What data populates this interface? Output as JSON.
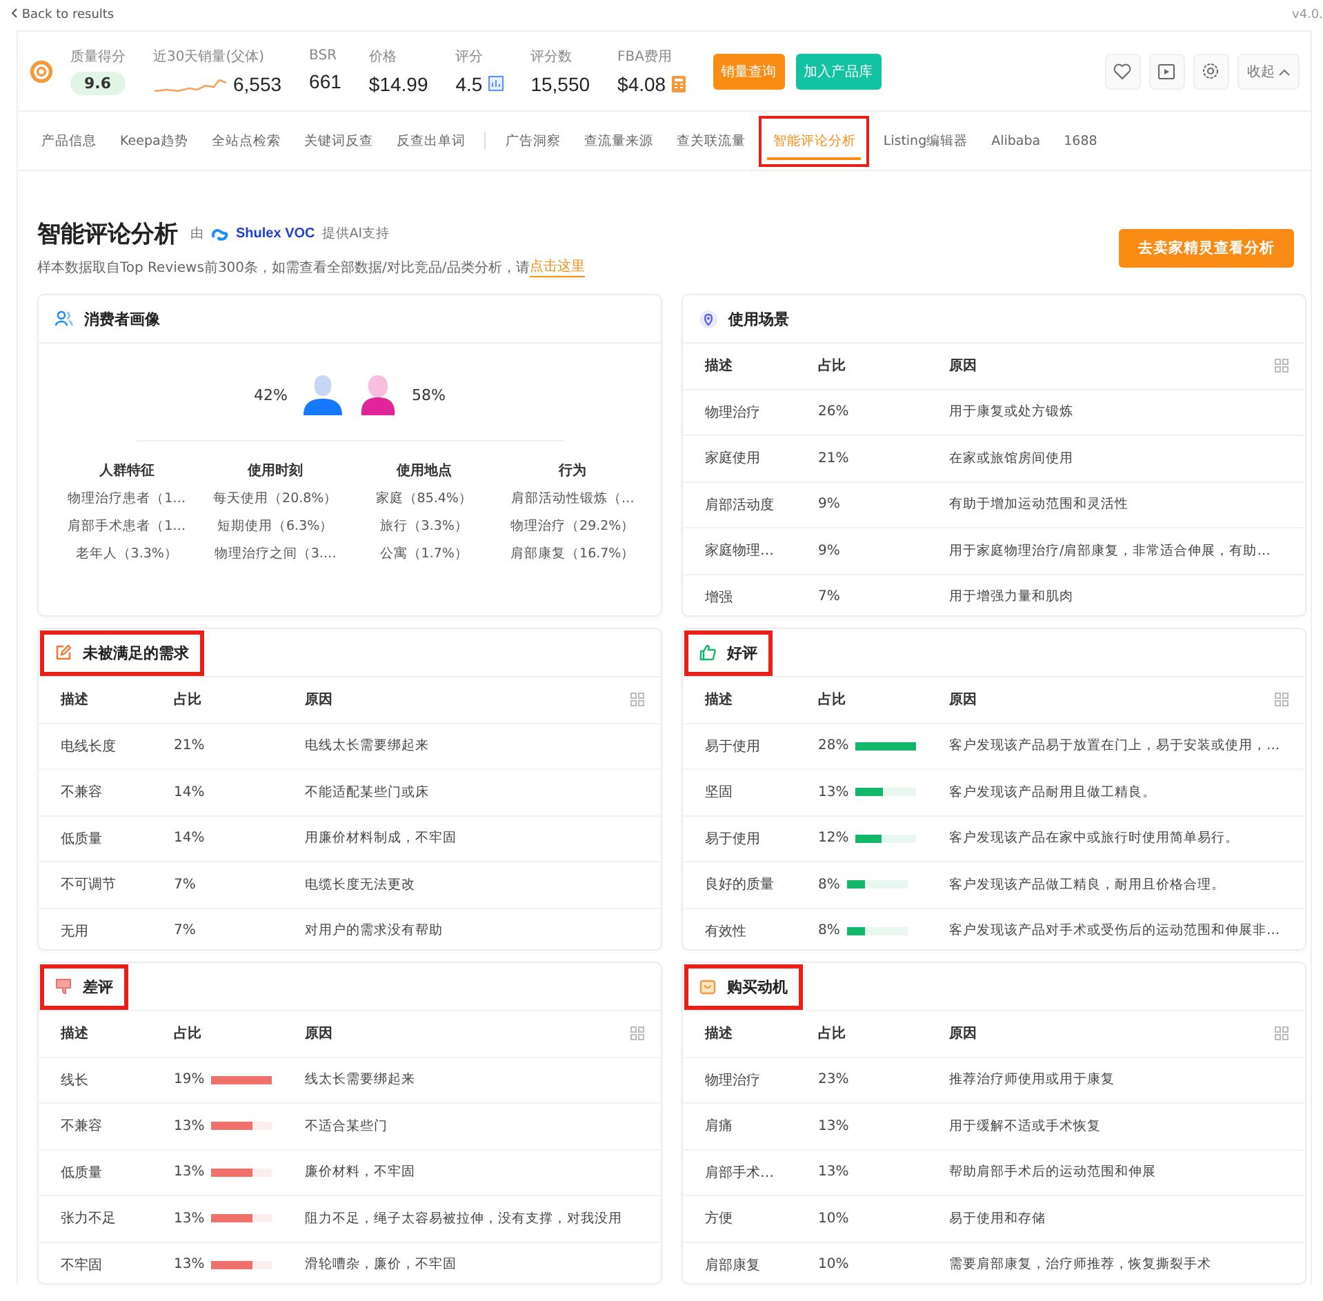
{
  "top_bar": {
    "back_link": "Back to results",
    "version": "v4.0."
  },
  "stats": [
    {
      "label": "质量得分",
      "value": "9.6",
      "kind": "badge"
    },
    {
      "label": "近30天销量(父体)",
      "value": "6,553",
      "kind": "sparkline"
    },
    {
      "label": "BSR",
      "value": "661",
      "kind": "plain"
    },
    {
      "label": "价格",
      "value": "$14.99",
      "kind": "plain"
    },
    {
      "label": "评分",
      "value": "4.5",
      "kind": "rating"
    },
    {
      "label": "评分数",
      "value": "15,550",
      "kind": "plain"
    },
    {
      "label": "FBA费用",
      "value": "$4.08",
      "kind": "calculator"
    }
  ],
  "action_buttons": [
    {
      "label": "销量查询",
      "color": "#fa8c16"
    },
    {
      "label": "加入产品库",
      "color": "#13c2a3"
    }
  ],
  "collapse_button": "收起",
  "tab_groups": [
    [
      {
        "label": "产品信息",
        "selected": false,
        "highlighted": false
      },
      {
        "label": "Keepa趋势",
        "selected": false,
        "highlighted": false
      },
      {
        "label": "全站点检索",
        "selected": false,
        "highlighted": false
      },
      {
        "label": "关键词反查",
        "selected": false,
        "highlighted": false
      },
      {
        "label": "反查出单词",
        "selected": false,
        "highlighted": false
      }
    ],
    [
      {
        "label": "广告洞察",
        "selected": false,
        "highlighted": false
      },
      {
        "label": "查流量来源",
        "selected": false,
        "highlighted": false
      },
      {
        "label": "查关联流量",
        "selected": false,
        "highlighted": false
      },
      {
        "label": "智能评论分析",
        "selected": true,
        "highlighted": true
      },
      {
        "label": "Listing编辑器",
        "selected": false,
        "highlighted": false
      },
      {
        "label": "Alibaba",
        "selected": false,
        "highlighted": false
      },
      {
        "label": "1688",
        "selected": false,
        "highlighted": false
      }
    ]
  ],
  "section": {
    "title": "智能评论分析",
    "by": "由",
    "brand": "Shulex VOC",
    "support": "提供AI支持",
    "note": "样本数据取自Top Reviews前300条，如需查看全部数据/对比竞品/品类分析，请",
    "note_link": "点击这里",
    "cta_button": "去卖家精灵查看分析"
  },
  "cards": [
    {
      "kind": "profile",
      "title": "消费者画像",
      "highlighted": false,
      "gender": [
        {
          "kind": "male",
          "share": "42%"
        },
        {
          "kind": "female",
          "share": "58%"
        }
      ],
      "columns": [
        {
          "heading": "人群特征",
          "items": [
            "物理治疗患者（1…",
            "肩部手术患者（1…",
            "老年人（3.3%）"
          ]
        },
        {
          "heading": "使用时刻",
          "items": [
            "每天使用（20.8%）",
            "短期使用（6.3%）",
            "物理治疗之间（3.…"
          ]
        },
        {
          "heading": "使用地点",
          "items": [
            "家庭（85.4%）",
            "旅行（3.3%）",
            "公寓（1.7%）"
          ]
        },
        {
          "heading": "行为",
          "items": [
            "肩部活动性锻炼（…",
            "物理治疗（29.2%）",
            "肩部康复（16.7%）"
          ]
        }
      ]
    },
    {
      "kind": "scenario",
      "title": "使用场景",
      "highlighted": false,
      "headers": [
        "描述",
        "占比",
        "原因"
      ],
      "rows": [
        {
          "description": "物理治疗",
          "share": "26%",
          "reason": "用于康复或处方锻炼"
        },
        {
          "description": "家庭使用",
          "share": "21%",
          "reason": "在家或旅馆房间使用"
        },
        {
          "description": "肩部活动度",
          "share": "9%",
          "reason": "有助于增加运动范围和灵活性"
        },
        {
          "description": "家庭物理…",
          "share": "9%",
          "reason": "用于家庭物理治疗/肩部康复，非常适合伸展，有助…"
        },
        {
          "description": "增强",
          "share": "7%",
          "reason": "用于增强力量和肌肉"
        }
      ]
    },
    {
      "kind": "unmet",
      "title": "未被满足的需求",
      "highlighted": true,
      "headers": [
        "描述",
        "占比",
        "原因"
      ],
      "rows": [
        {
          "description": "电线长度",
          "share": "21%",
          "reason": "电线太长需要绑起来"
        },
        {
          "description": "不兼容",
          "share": "14%",
          "reason": "不能适配某些门或床"
        },
        {
          "description": "低质量",
          "share": "14%",
          "reason": "用廉价材料制成，不牢固"
        },
        {
          "description": "不可调节",
          "share": "7%",
          "reason": "电缆长度无法更改"
        },
        {
          "description": "无用",
          "share": "7%",
          "reason": "对用户的需求没有帮助"
        }
      ]
    },
    {
      "kind": "positive",
      "title": "好评",
      "highlighted": true,
      "headers": [
        "描述",
        "占比",
        "原因"
      ],
      "rows": [
        {
          "description": "易于使用",
          "share": "28%",
          "level": 1,
          "reason": "客户发现该产品易于放置在门上，易于安装或使用，…"
        },
        {
          "description": "坚固",
          "share": "13%",
          "level": 0.46,
          "reason": "客户发现该产品耐用且做工精良。"
        },
        {
          "description": "易于使用",
          "share": "12%",
          "level": 0.43,
          "reason": "客户发现该产品在家中或旅行时使用简单易行。"
        },
        {
          "description": "良好的质量",
          "share": "8%",
          "level": 0.29,
          "reason": "客户发现该产品做工精良，耐用且价格合理。"
        },
        {
          "description": "有效性",
          "share": "8%",
          "level": 0.29,
          "reason": "客户发现该产品对手术或受伤后的运动范围和伸展非…"
        }
      ]
    },
    {
      "kind": "negative",
      "title": "差评",
      "highlighted": true,
      "headers": [
        "描述",
        "占比",
        "原因"
      ],
      "rows": [
        {
          "description": "线长",
          "share": "19%",
          "level": 1,
          "reason": "线太长需要绑起来"
        },
        {
          "description": "不兼容",
          "share": "13%",
          "level": 0.68,
          "reason": "不适合某些门"
        },
        {
          "description": "低质量",
          "share": "13%",
          "level": 0.68,
          "reason": "廉价材料，不牢固"
        },
        {
          "description": "张力不足",
          "share": "13%",
          "level": 0.68,
          "reason": "阻力不足，绳子太容易被拉伸，没有支撑，对我没用"
        },
        {
          "description": "不牢固",
          "share": "13%",
          "level": 0.68,
          "reason": "滑轮嘈杂，廉价，不牢固"
        }
      ]
    },
    {
      "kind": "motive",
      "title": "购买动机",
      "highlighted": true,
      "headers": [
        "描述",
        "占比",
        "原因"
      ],
      "rows": [
        {
          "description": "物理治疗",
          "share": "23%",
          "reason": "推荐治疗师使用或用于康复"
        },
        {
          "description": "肩痛",
          "share": "13%",
          "reason": "用于缓解不适或手术恢复"
        },
        {
          "description": "肩部手术…",
          "share": "13%",
          "reason": "帮助肩部手术后的运动范围和伸展"
        },
        {
          "description": "方便",
          "share": "10%",
          "reason": "易于使用和存储"
        },
        {
          "description": "肩部康复",
          "share": "10%",
          "reason": "需要肩部康复，治疗师推荐，恢复撕裂手术"
        }
      ]
    }
  ]
}
